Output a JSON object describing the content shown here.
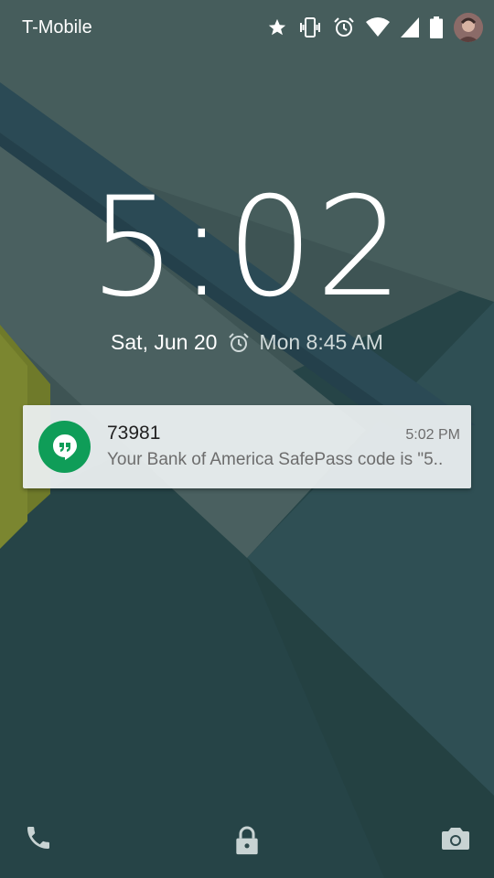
{
  "status_bar": {
    "carrier": "T-Mobile",
    "icons": [
      "star-icon",
      "vibrate-icon",
      "alarm-icon",
      "wifi-icon",
      "signal-icon",
      "battery-icon",
      "avatar"
    ]
  },
  "lockscreen": {
    "time": "5:02",
    "date": "Sat, Jun 20",
    "next_alarm": "Mon 8:45 AM"
  },
  "notification": {
    "app_icon": "hangouts-icon",
    "title": "73981",
    "time": "5:02 PM",
    "body": "Your Bank of America SafePass code is \"5.."
  },
  "bottom_bar": {
    "left": "phone-icon",
    "center": "lock-icon",
    "right": "camera-icon"
  },
  "colors": {
    "notification_accent": "#0f9d58",
    "wallpaper_base": "#3f5656"
  }
}
